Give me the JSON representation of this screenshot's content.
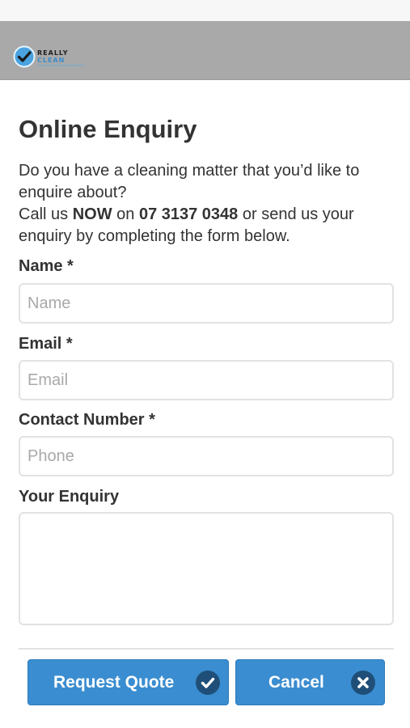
{
  "brand": {
    "name_top": "REALLY",
    "name_bottom": "CLEAN",
    "accent_color": "#3a8dd0",
    "header_color": "#a9a9a9"
  },
  "page": {
    "title": "Online Enquiry",
    "intro_line1": "Do you have a cleaning matter that you’d like to enquire about?",
    "intro_call_prefix": "Call us ",
    "intro_now": "NOW",
    "intro_on": " on ",
    "intro_phone": "07 3137 0348",
    "intro_call_suffix": " or send us your enquiry by completing the form below."
  },
  "form": {
    "name_label": "Name *",
    "name_placeholder": "Name",
    "email_label": "Email *",
    "email_placeholder": "Email",
    "contact_label": "Contact Number *",
    "contact_placeholder": "Phone",
    "enquiry_label": "Your Enquiry",
    "enquiry_value": ""
  },
  "buttons": {
    "request_quote_label": "Request Quote",
    "request_quote_icon": "check-circle-icon",
    "cancel_label": "Cancel",
    "cancel_icon": "close-circle-icon"
  }
}
